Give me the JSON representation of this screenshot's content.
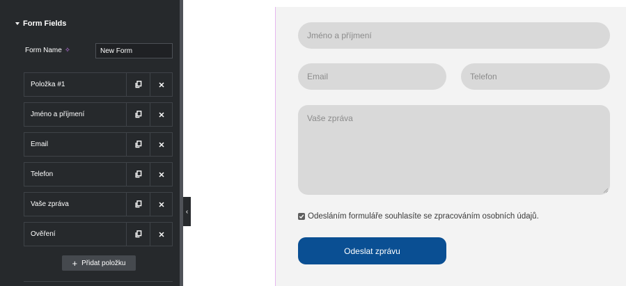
{
  "panel": {
    "section_title": "Form Fields",
    "form_name_label": "Form Name",
    "form_name_value": "New Form",
    "items": [
      {
        "label": "Položka #1"
      },
      {
        "label": "Jméno a příjmení"
      },
      {
        "label": "Email"
      },
      {
        "label": "Telefon"
      },
      {
        "label": "Vaše zpráva"
      },
      {
        "label": "Ověření"
      }
    ],
    "add_label": "Přidat položku",
    "add_icon": "plus-icon",
    "duplicate_icon": "duplicate-icon",
    "remove_icon": "close-icon",
    "ai_icon": "sparkle-icon",
    "collapse_icon": "chevron-left-icon"
  },
  "form": {
    "name_placeholder": "Jméno a příjmení",
    "email_placeholder": "Email",
    "phone_placeholder": "Telefon",
    "message_placeholder": "Vaše zpráva",
    "consent_text": "Odesláním formuláře souhlasíte se zpracováním osobních údajů.",
    "consent_checked": true,
    "submit_label": "Odeslat zprávu"
  },
  "colors": {
    "panel_bg": "#26292c",
    "canvas_bg": "#f3f3f3",
    "field_bg": "#d9d9d9",
    "submit_bg": "#0a4f93",
    "canvas_border": "#e6b7ee"
  }
}
